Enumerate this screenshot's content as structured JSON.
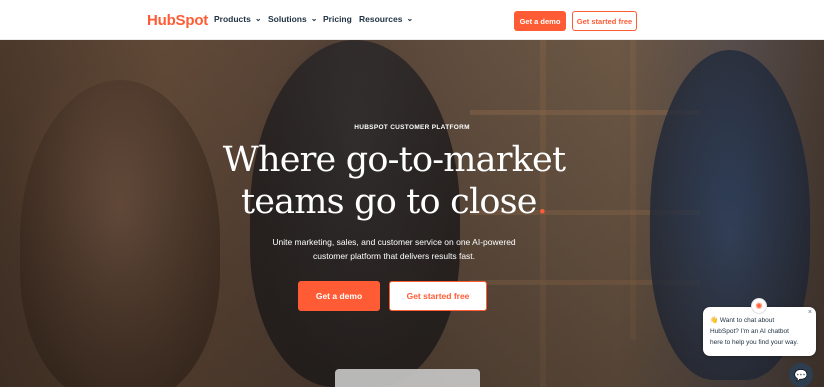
{
  "nav": {
    "logo": "HubSpot",
    "links": [
      {
        "label": "Products",
        "has_dropdown": true
      },
      {
        "label": "Solutions",
        "has_dropdown": true
      },
      {
        "label": "Pricing",
        "has_dropdown": false
      },
      {
        "label": "Resources",
        "has_dropdown": true
      }
    ],
    "cta_demo": "Get a demo",
    "cta_start": "Get started free"
  },
  "hero": {
    "eyebrow": "HUBSPOT CUSTOMER PLATFORM",
    "headline_line1": "Where go-to-market",
    "headline_line2_start": "teams go to ",
    "headline_line2_emphasis": "close",
    "headline_line2_dot": ".",
    "subtext_line1": "Unite marketing, sales, and customer service on one AI-powered",
    "subtext_line2": "customer platform that delivers results fast.",
    "cta_demo": "Get a demo",
    "cta_start": "Get started free"
  },
  "chat": {
    "line1": "👋 Want to chat about",
    "line2": "HubSpot? I'm an AI chatbot",
    "line3": "here to help you find your way.",
    "close_glyph": "×",
    "avatar_glyph": "✺",
    "launcher_glyph": "💬"
  },
  "colors": {
    "brand_orange": "#ff5c35",
    "nav_text": "#213343",
    "chat_launcher": "#2d3e50"
  },
  "icons": {
    "dropdown": "chevron-down-icon",
    "close": "close-icon",
    "chat": "chat-icon",
    "bot_avatar": "sprocket-avatar-icon"
  }
}
